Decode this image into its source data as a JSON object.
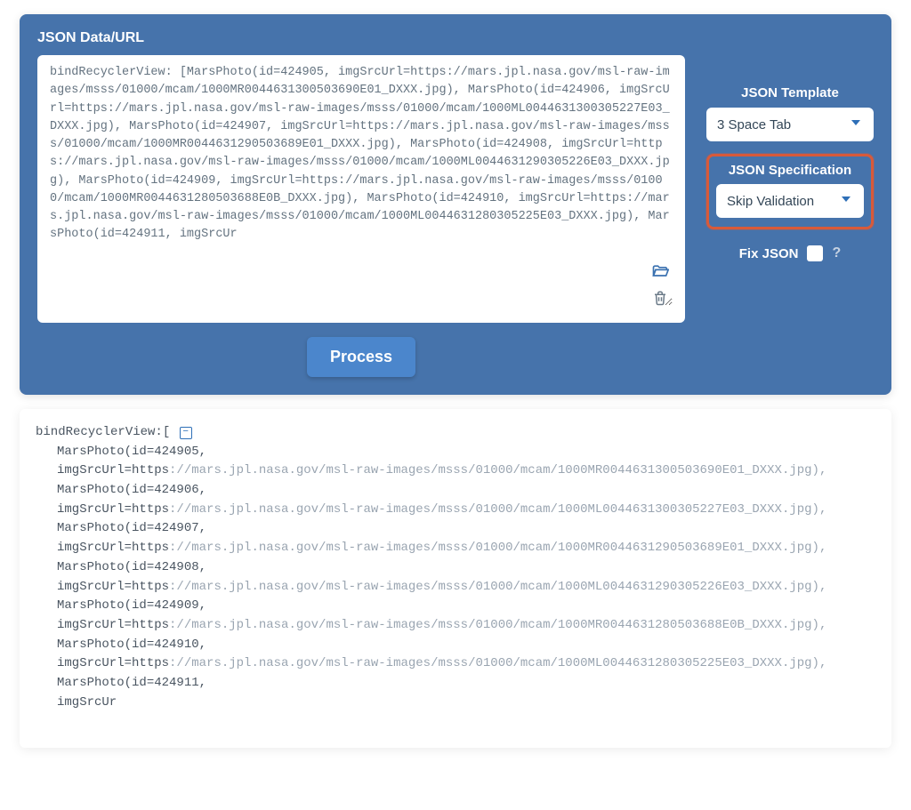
{
  "header": {
    "title": "JSON Data/URL"
  },
  "input": {
    "value": "bindRecyclerView: [MarsPhoto(id=424905, imgSrcUrl=https://mars.jpl.nasa.gov/msl-raw-images/msss/01000/mcam/1000MR0044631300503690E01_DXXX.jpg), MarsPhoto(id=424906, imgSrcUrl=https://mars.jpl.nasa.gov/msl-raw-images/msss/01000/mcam/1000ML0044631300305227E03_DXXX.jpg), MarsPhoto(id=424907, imgSrcUrl=https://mars.jpl.nasa.gov/msl-raw-images/msss/01000/mcam/1000MR0044631290503689E01_DXXX.jpg), MarsPhoto(id=424908, imgSrcUrl=https://mars.jpl.nasa.gov/msl-raw-images/msss/01000/mcam/1000ML0044631290305226E03_DXXX.jpg), MarsPhoto(id=424909, imgSrcUrl=https://mars.jpl.nasa.gov/msl-raw-images/msss/01000/mcam/1000MR0044631280503688E0B_DXXX.jpg), MarsPhoto(id=424910, imgSrcUrl=https://mars.jpl.nasa.gov/msl-raw-images/msss/01000/mcam/1000ML0044631280305225E03_DXXX.jpg), MarsPhoto(id=424911, imgSrcUr"
  },
  "sidebar": {
    "template_label": "JSON Template",
    "template_value": "3 Space Tab",
    "spec_label": "JSON Specification",
    "spec_value": "Skip Validation",
    "fixjson_label": "Fix JSON",
    "fixjson_checked": false,
    "help_symbol": "?"
  },
  "actions": {
    "process_label": "Process"
  },
  "output": {
    "first_key": "bindRecyclerView",
    "open": ":[",
    "collapse_symbol": "⊟",
    "lines": [
      {
        "k": "MarsPhoto(id=424905,",
        "c": ""
      },
      {
        "k": "imgSrcUrl=https",
        "c": "://mars.jpl.nasa.gov/msl-raw-images/msss/01000/mcam/1000MR0044631300503690E01_DXXX.jpg),"
      },
      {
        "k": "MarsPhoto(id=424906,",
        "c": ""
      },
      {
        "k": "imgSrcUrl=https",
        "c": "://mars.jpl.nasa.gov/msl-raw-images/msss/01000/mcam/1000ML0044631300305227E03_DXXX.jpg),"
      },
      {
        "k": "MarsPhoto(id=424907,",
        "c": ""
      },
      {
        "k": "imgSrcUrl=https",
        "c": "://mars.jpl.nasa.gov/msl-raw-images/msss/01000/mcam/1000MR0044631290503689E01_DXXX.jpg),"
      },
      {
        "k": "MarsPhoto(id=424908,",
        "c": ""
      },
      {
        "k": "imgSrcUrl=https",
        "c": "://mars.jpl.nasa.gov/msl-raw-images/msss/01000/mcam/1000ML0044631290305226E03_DXXX.jpg),"
      },
      {
        "k": "MarsPhoto(id=424909,",
        "c": ""
      },
      {
        "k": "imgSrcUrl=https",
        "c": "://mars.jpl.nasa.gov/msl-raw-images/msss/01000/mcam/1000MR0044631280503688E0B_DXXX.jpg),"
      },
      {
        "k": "MarsPhoto(id=424910,",
        "c": ""
      },
      {
        "k": "imgSrcUrl=https",
        "c": "://mars.jpl.nasa.gov/msl-raw-images/msss/01000/mcam/1000ML0044631280305225E03_DXXX.jpg),"
      },
      {
        "k": "MarsPhoto(id=424911,",
        "c": ""
      },
      {
        "k": "imgSrcUr",
        "c": ""
      }
    ]
  }
}
